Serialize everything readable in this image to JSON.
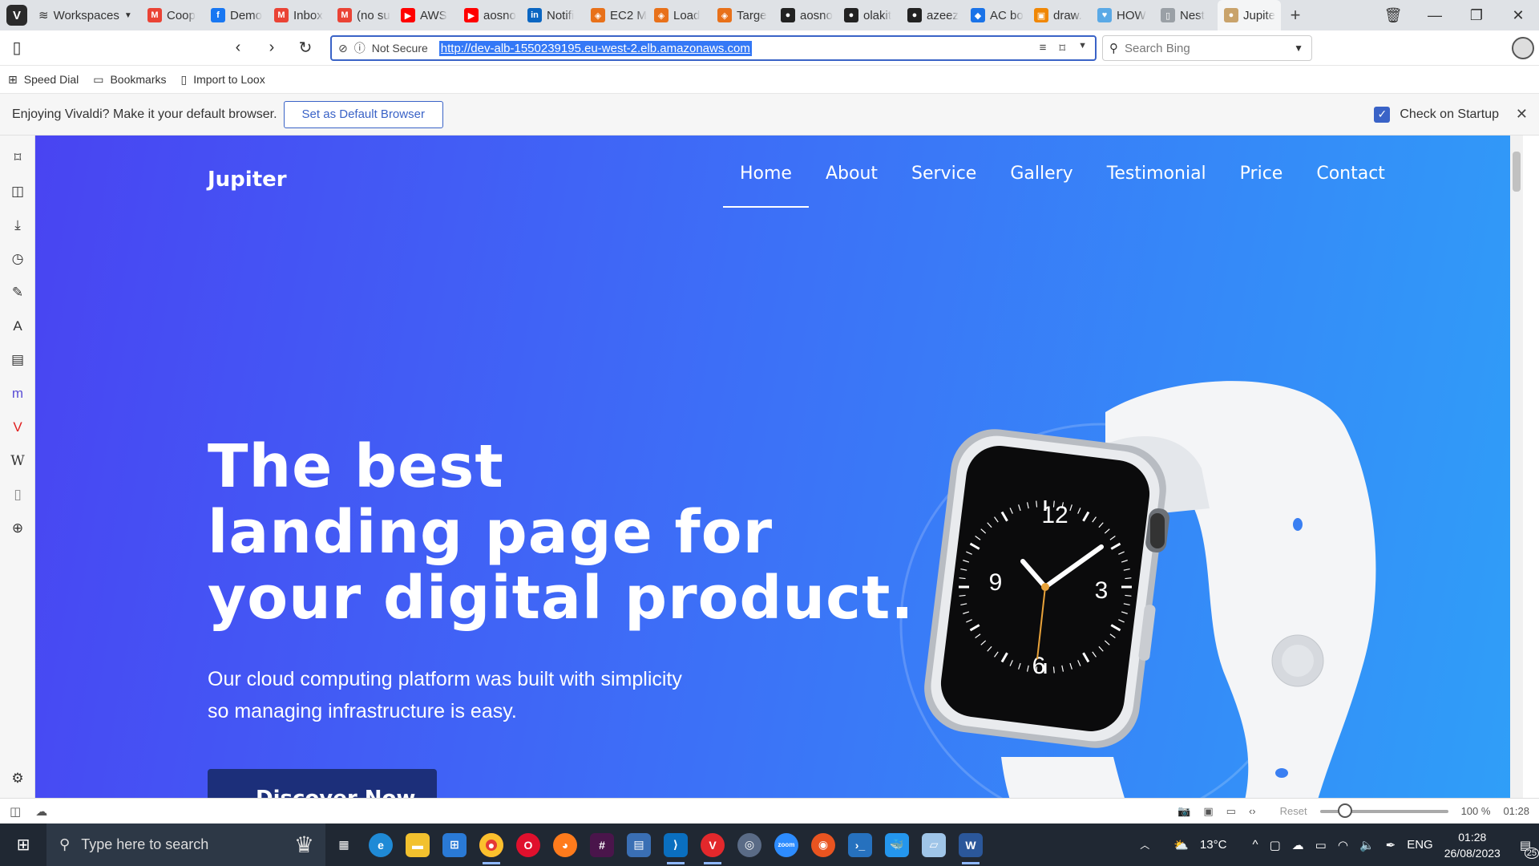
{
  "tabbar": {
    "workspaces_label": "Workspaces",
    "tabs": [
      {
        "label": "Coop",
        "icon": "gmail",
        "color": "#ea4335",
        "glyph": "M"
      },
      {
        "label": "Demo",
        "icon": "facebook",
        "color": "#1877f2",
        "glyph": "f"
      },
      {
        "label": "Inbox",
        "icon": "gmail",
        "color": "#ea4335",
        "glyph": "M"
      },
      {
        "label": "(no su",
        "icon": "gmail",
        "color": "#ea4335",
        "glyph": "M"
      },
      {
        "label": "AWS",
        "icon": "youtube",
        "color": "#ff0000",
        "glyph": "▶"
      },
      {
        "label": "aosno",
        "icon": "youtube",
        "color": "#ff0000",
        "glyph": "▶"
      },
      {
        "label": "Notifi",
        "icon": "linkedin",
        "color": "#0a66c2",
        "glyph": "in"
      },
      {
        "label": "EC2 M",
        "icon": "aws",
        "color": "#e8711a",
        "glyph": "◈"
      },
      {
        "label": "Load",
        "icon": "aws",
        "color": "#e8711a",
        "glyph": "◈"
      },
      {
        "label": "Targe",
        "icon": "aws",
        "color": "#e8711a",
        "glyph": "◈"
      },
      {
        "label": "aosno",
        "icon": "github",
        "color": "#222222",
        "glyph": "●"
      },
      {
        "label": "olakit",
        "icon": "github",
        "color": "#222222",
        "glyph": "●"
      },
      {
        "label": "azeez",
        "icon": "github",
        "color": "#222222",
        "glyph": "●"
      },
      {
        "label": "AC bo",
        "icon": "diamond",
        "color": "#1a73e8",
        "glyph": "◆"
      },
      {
        "label": "draw.",
        "icon": "drawio",
        "color": "#f08705",
        "glyph": "▣"
      },
      {
        "label": "HOW",
        "icon": "heart",
        "color": "#5aa9e6",
        "glyph": "♥"
      },
      {
        "label": "Nest",
        "icon": "page",
        "color": "#9aa0a6",
        "glyph": "▯"
      },
      {
        "label": "Jupite",
        "icon": "jupiter",
        "color": "#c9a36b",
        "glyph": "●",
        "active": true
      }
    ]
  },
  "addressbar": {
    "security_label": "Not Secure",
    "url": "http://dev-alb-1550239195.eu-west-2.elb.amazonaws.com",
    "search_placeholder": "Search Bing"
  },
  "bookmarks": {
    "items": [
      "Speed Dial",
      "Bookmarks",
      "Import to Loox"
    ]
  },
  "notification": {
    "message": "Enjoying Vivaldi? Make it your default browser.",
    "button_label": "Set as Default Browser",
    "checkbox_label": "Check on Startup",
    "checkbox_checked": true
  },
  "page": {
    "brand": "Jupiter",
    "nav": [
      "Home",
      "About",
      "Service",
      "Gallery",
      "Testimonial",
      "Price",
      "Contact"
    ],
    "nav_active": "Home",
    "hero_lines": [
      "The best",
      "landing page for",
      "your digital product."
    ],
    "subtitle_lines": [
      "Our cloud computing platform was built with simplicity",
      "so managing infrastructure is easy."
    ],
    "cta_label": "Discover Now",
    "watch_numerals": [
      "12",
      "3",
      "6",
      "9"
    ],
    "gradient": [
      "#4944f2",
      "#3d6ef7",
      "#2f9ff8"
    ]
  },
  "statusbar": {
    "reset_label": "Reset",
    "zoom": "100 %",
    "zoom_level": 1.0,
    "time": "01:28"
  },
  "taskbar": {
    "search_placeholder": "Type here to search",
    "weather": "13°C",
    "language": "ENG",
    "clock_time": "01:28",
    "clock_date": "26/08/2023",
    "notification_count": "25"
  }
}
